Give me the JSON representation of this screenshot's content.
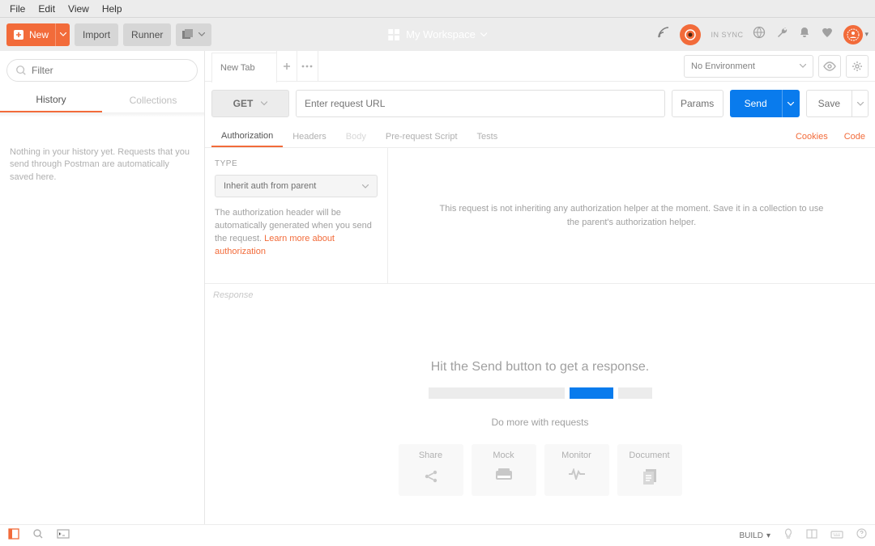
{
  "menu": {
    "file": "File",
    "edit": "Edit",
    "view": "View",
    "help": "Help"
  },
  "toolbar": {
    "new": "New",
    "import": "Import",
    "runner": "Runner",
    "workspace": "My Workspace",
    "sync": "IN SYNC"
  },
  "sidebar": {
    "filter_placeholder": "Filter",
    "tabs": {
      "history": "History",
      "collections": "Collections"
    },
    "empty": "Nothing in your history yet. Requests that you send through Postman are automatically saved here."
  },
  "tab": {
    "title": "New Tab"
  },
  "environment": {
    "none": "No Environment"
  },
  "request": {
    "method": "GET",
    "url_placeholder": "Enter request URL",
    "params": "Params",
    "send": "Send",
    "save": "Save"
  },
  "reqtabs": {
    "authorization": "Authorization",
    "headers": "Headers",
    "body": "Body",
    "prerequest": "Pre-request Script",
    "tests": "Tests",
    "cookies": "Cookies",
    "code": "Code"
  },
  "auth": {
    "type_label": "TYPE",
    "selected": "Inherit auth from parent",
    "help_text": "The authorization header will be automatically generated when you send the request. ",
    "help_link": "Learn more about authorization",
    "right_msg": "This request is not inheriting any authorization helper at the moment. Save it in a collection to use the parent's authorization helper."
  },
  "response": {
    "label": "Response",
    "hitsend": "Hit the Send button to get a response.",
    "domore": "Do more with requests",
    "cards": {
      "share": "Share",
      "mock": "Mock",
      "monitor": "Monitor",
      "document": "Document"
    }
  },
  "status": {
    "build": "BUILD"
  }
}
